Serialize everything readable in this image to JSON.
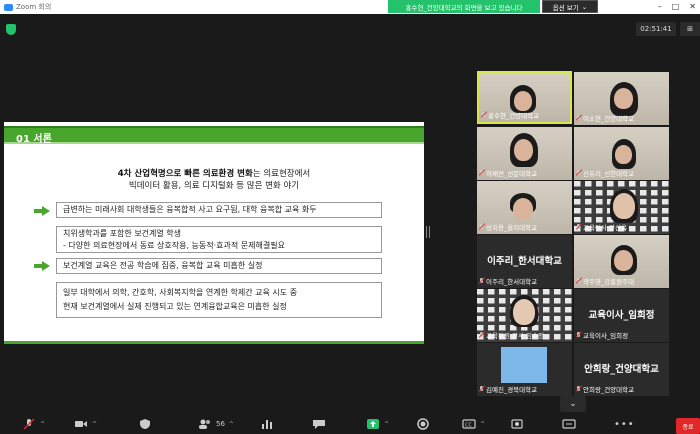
{
  "window": {
    "title": "Zoom 회의"
  },
  "banner": {
    "sharing_text": "홍수현_건양대학교의 화면을 보고 있습니다",
    "view_options": "옵션 보기"
  },
  "meeting": {
    "timer": "02:51:41",
    "view_label": "보기"
  },
  "slide": {
    "section": "01 서론",
    "intro_bold": "4차 산업혁명으로 빠른 의료환경 변화",
    "intro_rest": "는 의료현장에서",
    "intro_line2": "빅데이터 활용, 의료 디지털화 등 많은 변화 야기",
    "box1": "급변하는 미래사회 대학생들은 융복합적 사고 요구됨, 대학 융복합 교육 화두",
    "box2_l1": "치위생학과를 포함한 보건계열 학생",
    "box2_l2": " - 다양한 의료현장에서 동료 상호작용, 능동적·효과적 문제해결필요",
    "box3": "보건계열 교육은 전공 학습에 집중, 융복합 교육 미흡한 실정",
    "box4_l1": "일부 대학에서 의학, 간호학, 사회복지학을 연계한 학제간 교육 시도 중",
    "box4_l2": "현재 보건계열에서 실제 진행되고 있는 연계융합교육은 미흡한 실정"
  },
  "participants": [
    {
      "name": "홍수현_건양대학교",
      "big": ""
    },
    {
      "name": "이소현_건양대학교",
      "big": ""
    },
    {
      "name": "허채연_선문대학교",
      "big": ""
    },
    {
      "name": "신유리_신한대학교",
      "big": ""
    },
    {
      "name": "성치용_을지대학교",
      "big": ""
    },
    {
      "name": "교육이사 장선옥",
      "big": ""
    },
    {
      "name": "이주리_한서대학교",
      "big": "이주리_한서대학교"
    },
    {
      "name": "곽주영_강릉원주대",
      "big": ""
    },
    {
      "name": "교육위원 간사 임수정",
      "big": ""
    },
    {
      "name": "교육이사_임희정",
      "big": "교육이사_임희정"
    },
    {
      "name": "김예진_경북대학교",
      "big": ""
    },
    {
      "name": "안희랑_건양대학교",
      "big": "안희랑_건양대학교"
    }
  ],
  "toolbar": {
    "participants_count": "56",
    "leave": "종료"
  },
  "colors": {
    "accent": "#47a62b",
    "active_border": "#d8e64a",
    "banner": "#23c26b",
    "leave": "#e02828"
  }
}
